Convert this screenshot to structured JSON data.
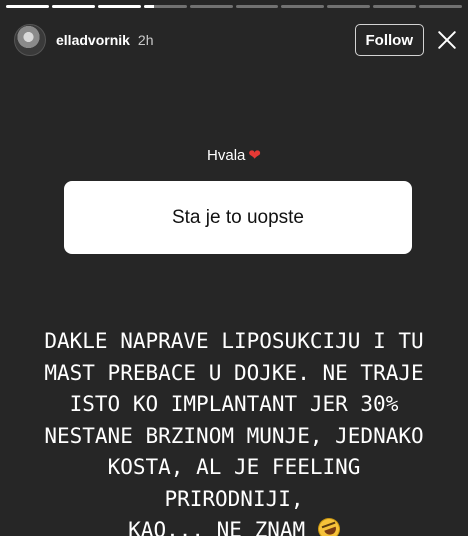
{
  "story": {
    "progress": [
      1,
      1,
      1,
      0.25,
      0,
      0,
      0,
      0,
      0,
      0
    ],
    "username": "elladvornik",
    "time": "2h",
    "follow_label": "Follow",
    "close_icon": "close-icon",
    "avatar_icon": "avatar"
  },
  "question_sticker": {
    "question": "Hvala",
    "question_emoji": "heart-emoji",
    "answer": "Sta je to uopste"
  },
  "caption": {
    "lines": [
      "DAKLE NAPRAVE LIPOSUKCIJU I TU",
      "MAST PREBACE U DOJKE. NE TRAJE",
      "ISTO KO IMPLANTANT JER 30%",
      "NESTANE BRZINOM MUNJE, JEDNAKO",
      "KOSTA, AL JE FEELING PRIRODNIJI,",
      "KAO... NE ZNAM"
    ],
    "end_emoji": "rolling-on-floor-laughing-emoji"
  }
}
